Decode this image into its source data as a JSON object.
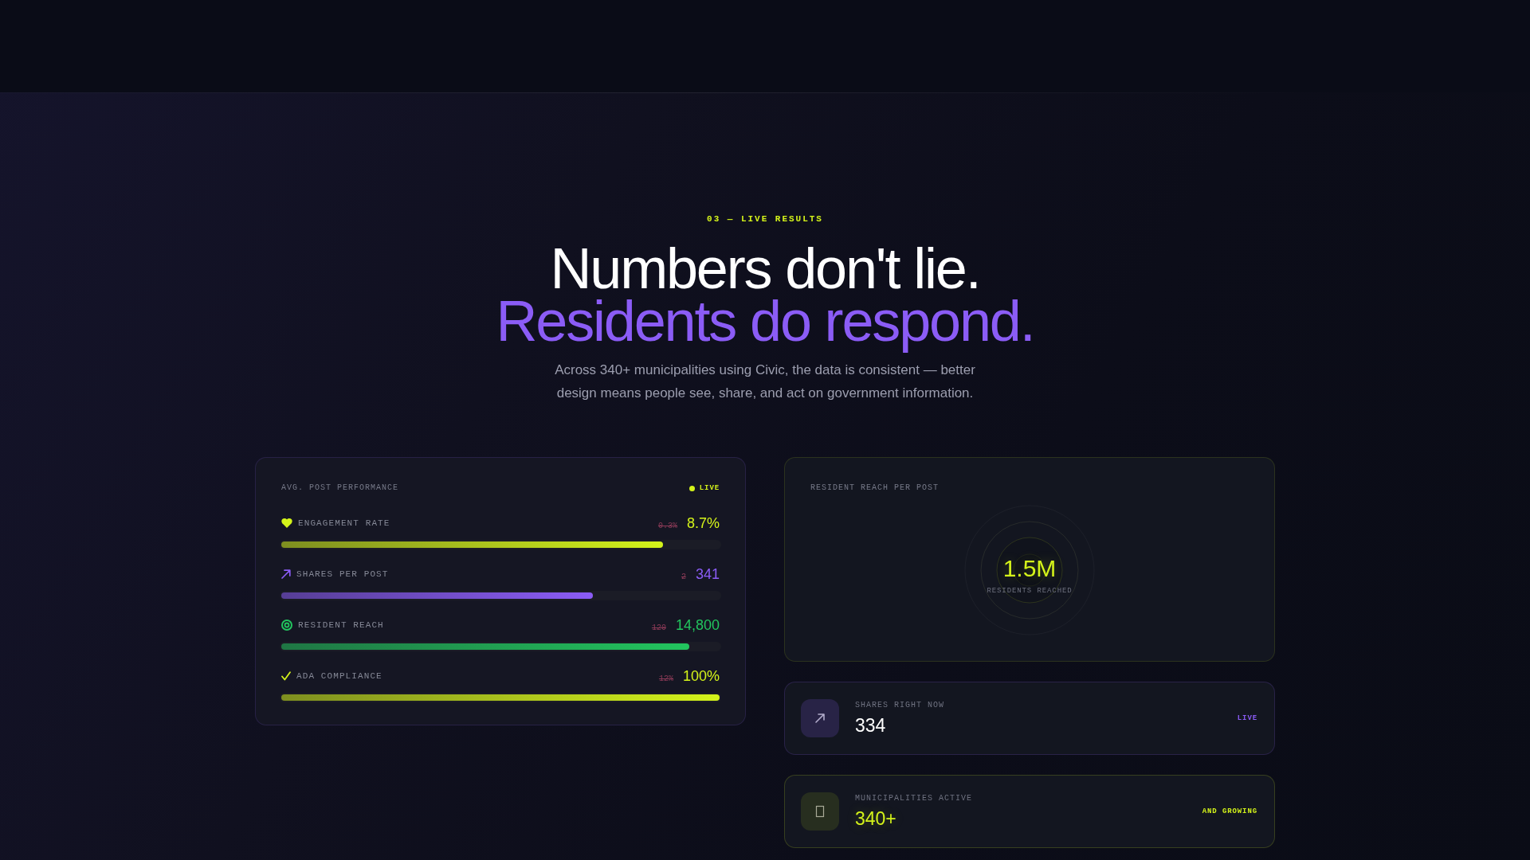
{
  "header": {
    "eyebrow": "03 — LIVE RESULTS",
    "title": "Numbers don't lie.",
    "title_accent": "Residents do respond.",
    "description": "Across 340+ municipalities using Civic, the data is consistent — better design means people see, share, and act on government information."
  },
  "performance": {
    "title": "AVG. POST PERFORMANCE",
    "status": "LIVE",
    "metrics": [
      {
        "label": "ENGAGEMENT RATE",
        "previous": "0.3%",
        "value": "8.7%",
        "level": 0.87,
        "color": "#d4f31a"
      },
      {
        "label": "SHARES PER POST",
        "previous": "2",
        "value": "341",
        "level": 0.71,
        "color": "#8b5cf6"
      },
      {
        "label": "RESIDENT REACH",
        "previous": "120",
        "value": "14,800",
        "level": 0.93,
        "color": "#22c55e"
      },
      {
        "label": "ADA COMPLIANCE",
        "previous": "12%",
        "value": "100%",
        "level": 1,
        "color": "#d4f31a"
      }
    ]
  },
  "reach": {
    "title": "RESIDENT REACH PER POST",
    "value": "1.5M",
    "caption": "RESIDENTS REACHED"
  },
  "stats": [
    {
      "kind": "live",
      "label": "SHARES RIGHT NOW",
      "value": "334",
      "tag": "LIVE",
      "color": "#8b5cf6"
    },
    {
      "kind": "total",
      "label": "MUNICIPALITIES ACTIVE",
      "value": "340+",
      "tag": "AND GROWING",
      "color": "#d4f31a"
    }
  ]
}
